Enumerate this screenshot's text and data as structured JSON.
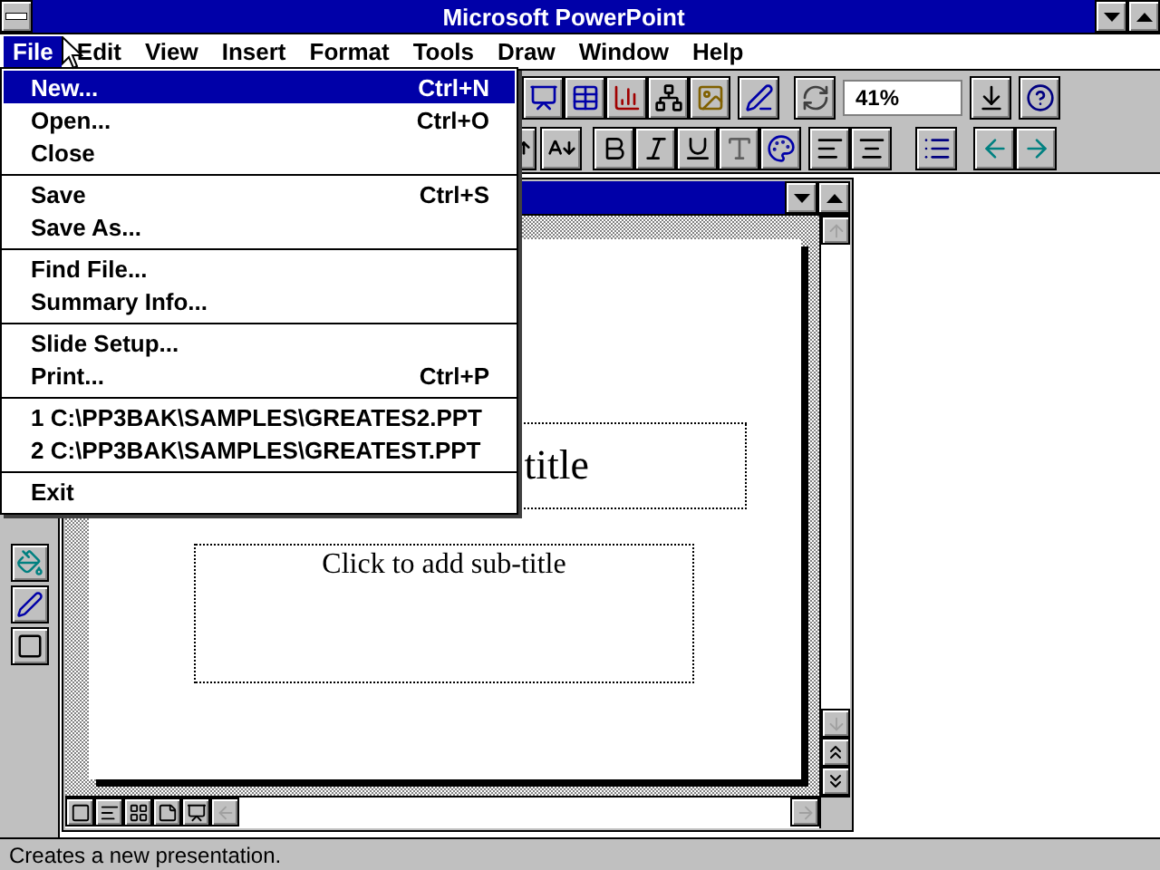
{
  "window": {
    "title": "Microsoft PowerPoint"
  },
  "menubar": [
    {
      "label": "File",
      "selected": true
    },
    {
      "label": "Edit",
      "selected": false
    },
    {
      "label": "View",
      "selected": false
    },
    {
      "label": "Insert",
      "selected": false
    },
    {
      "label": "Format",
      "selected": false
    },
    {
      "label": "Tools",
      "selected": false
    },
    {
      "label": "Draw",
      "selected": false
    },
    {
      "label": "Window",
      "selected": false
    },
    {
      "label": "Help",
      "selected": false
    }
  ],
  "file_menu": {
    "groups": [
      {
        "items": [
          {
            "label": "New...",
            "shortcut": "Ctrl+N",
            "selected": true
          },
          {
            "label": "Open...",
            "shortcut": "Ctrl+O",
            "selected": false
          },
          {
            "label": "Close",
            "selected": false
          }
        ]
      },
      {
        "items": [
          {
            "label": "Save",
            "shortcut": "Ctrl+S",
            "selected": false
          },
          {
            "label": "Save As...",
            "selected": false
          }
        ]
      },
      {
        "items": [
          {
            "label": "Find File...",
            "selected": false
          },
          {
            "label": "Summary Info...",
            "selected": false
          }
        ]
      },
      {
        "items": [
          {
            "label": "Slide Setup...",
            "selected": false
          },
          {
            "label": "Print...",
            "shortcut": "Ctrl+P",
            "selected": false
          }
        ]
      },
      {
        "items": [
          {
            "label": "1 C:\\PP3BAK\\SAMPLES\\GREATES2.PPT",
            "selected": false
          },
          {
            "label": "2 C:\\PP3BAK\\SAMPLES\\GREATEST.PPT",
            "selected": false
          }
        ]
      },
      {
        "items": [
          {
            "label": "Exit",
            "selected": false
          }
        ]
      }
    ]
  },
  "toolbar": {
    "zoom": "41%"
  },
  "slide": {
    "title_placeholder": "title",
    "subtitle_placeholder": "Click to add sub-title"
  },
  "status_bar": "Creates a new presentation."
}
